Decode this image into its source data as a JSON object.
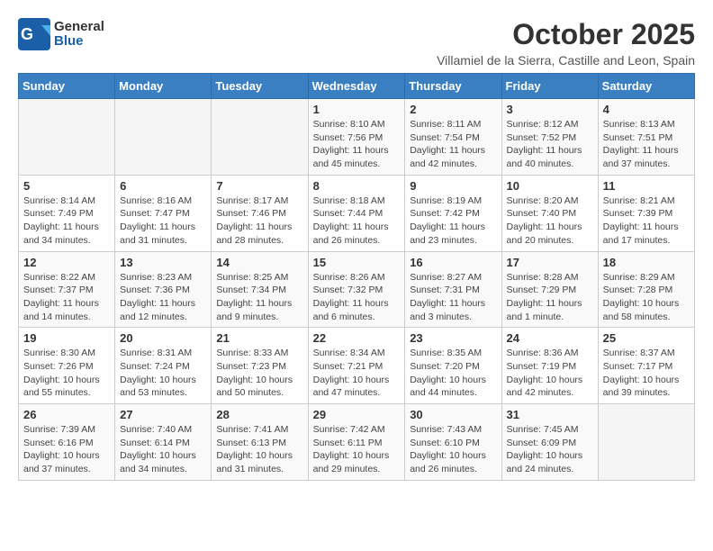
{
  "header": {
    "logo_general": "General",
    "logo_blue": "Blue",
    "month_year": "October 2025",
    "location": "Villamiel de la Sierra, Castille and Leon, Spain"
  },
  "weekdays": [
    "Sunday",
    "Monday",
    "Tuesday",
    "Wednesday",
    "Thursday",
    "Friday",
    "Saturday"
  ],
  "weeks": [
    [
      {
        "day": "",
        "info": ""
      },
      {
        "day": "",
        "info": ""
      },
      {
        "day": "",
        "info": ""
      },
      {
        "day": "1",
        "info": "Sunrise: 8:10 AM\nSunset: 7:56 PM\nDaylight: 11 hours and 45 minutes."
      },
      {
        "day": "2",
        "info": "Sunrise: 8:11 AM\nSunset: 7:54 PM\nDaylight: 11 hours and 42 minutes."
      },
      {
        "day": "3",
        "info": "Sunrise: 8:12 AM\nSunset: 7:52 PM\nDaylight: 11 hours and 40 minutes."
      },
      {
        "day": "4",
        "info": "Sunrise: 8:13 AM\nSunset: 7:51 PM\nDaylight: 11 hours and 37 minutes."
      }
    ],
    [
      {
        "day": "5",
        "info": "Sunrise: 8:14 AM\nSunset: 7:49 PM\nDaylight: 11 hours and 34 minutes."
      },
      {
        "day": "6",
        "info": "Sunrise: 8:16 AM\nSunset: 7:47 PM\nDaylight: 11 hours and 31 minutes."
      },
      {
        "day": "7",
        "info": "Sunrise: 8:17 AM\nSunset: 7:46 PM\nDaylight: 11 hours and 28 minutes."
      },
      {
        "day": "8",
        "info": "Sunrise: 8:18 AM\nSunset: 7:44 PM\nDaylight: 11 hours and 26 minutes."
      },
      {
        "day": "9",
        "info": "Sunrise: 8:19 AM\nSunset: 7:42 PM\nDaylight: 11 hours and 23 minutes."
      },
      {
        "day": "10",
        "info": "Sunrise: 8:20 AM\nSunset: 7:40 PM\nDaylight: 11 hours and 20 minutes."
      },
      {
        "day": "11",
        "info": "Sunrise: 8:21 AM\nSunset: 7:39 PM\nDaylight: 11 hours and 17 minutes."
      }
    ],
    [
      {
        "day": "12",
        "info": "Sunrise: 8:22 AM\nSunset: 7:37 PM\nDaylight: 11 hours and 14 minutes."
      },
      {
        "day": "13",
        "info": "Sunrise: 8:23 AM\nSunset: 7:36 PM\nDaylight: 11 hours and 12 minutes."
      },
      {
        "day": "14",
        "info": "Sunrise: 8:25 AM\nSunset: 7:34 PM\nDaylight: 11 hours and 9 minutes."
      },
      {
        "day": "15",
        "info": "Sunrise: 8:26 AM\nSunset: 7:32 PM\nDaylight: 11 hours and 6 minutes."
      },
      {
        "day": "16",
        "info": "Sunrise: 8:27 AM\nSunset: 7:31 PM\nDaylight: 11 hours and 3 minutes."
      },
      {
        "day": "17",
        "info": "Sunrise: 8:28 AM\nSunset: 7:29 PM\nDaylight: 11 hours and 1 minute."
      },
      {
        "day": "18",
        "info": "Sunrise: 8:29 AM\nSunset: 7:28 PM\nDaylight: 10 hours and 58 minutes."
      }
    ],
    [
      {
        "day": "19",
        "info": "Sunrise: 8:30 AM\nSunset: 7:26 PM\nDaylight: 10 hours and 55 minutes."
      },
      {
        "day": "20",
        "info": "Sunrise: 8:31 AM\nSunset: 7:24 PM\nDaylight: 10 hours and 53 minutes."
      },
      {
        "day": "21",
        "info": "Sunrise: 8:33 AM\nSunset: 7:23 PM\nDaylight: 10 hours and 50 minutes."
      },
      {
        "day": "22",
        "info": "Sunrise: 8:34 AM\nSunset: 7:21 PM\nDaylight: 10 hours and 47 minutes."
      },
      {
        "day": "23",
        "info": "Sunrise: 8:35 AM\nSunset: 7:20 PM\nDaylight: 10 hours and 44 minutes."
      },
      {
        "day": "24",
        "info": "Sunrise: 8:36 AM\nSunset: 7:19 PM\nDaylight: 10 hours and 42 minutes."
      },
      {
        "day": "25",
        "info": "Sunrise: 8:37 AM\nSunset: 7:17 PM\nDaylight: 10 hours and 39 minutes."
      }
    ],
    [
      {
        "day": "26",
        "info": "Sunrise: 7:39 AM\nSunset: 6:16 PM\nDaylight: 10 hours and 37 minutes."
      },
      {
        "day": "27",
        "info": "Sunrise: 7:40 AM\nSunset: 6:14 PM\nDaylight: 10 hours and 34 minutes."
      },
      {
        "day": "28",
        "info": "Sunrise: 7:41 AM\nSunset: 6:13 PM\nDaylight: 10 hours and 31 minutes."
      },
      {
        "day": "29",
        "info": "Sunrise: 7:42 AM\nSunset: 6:11 PM\nDaylight: 10 hours and 29 minutes."
      },
      {
        "day": "30",
        "info": "Sunrise: 7:43 AM\nSunset: 6:10 PM\nDaylight: 10 hours and 26 minutes."
      },
      {
        "day": "31",
        "info": "Sunrise: 7:45 AM\nSunset: 6:09 PM\nDaylight: 10 hours and 24 minutes."
      },
      {
        "day": "",
        "info": ""
      }
    ]
  ]
}
